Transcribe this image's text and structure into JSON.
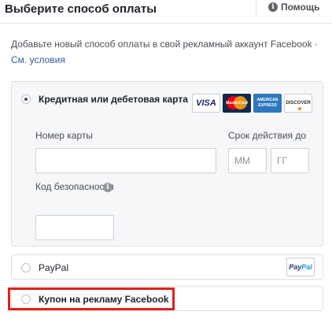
{
  "header": {
    "title": "Выберите способ оплаты",
    "help_label": "Помощь",
    "help_icon_glyph": "i"
  },
  "description": {
    "text": "Добавьте новый способ оплаты в свой рекламный аккаунт Facebook ·",
    "link": "См. условия"
  },
  "card_option": {
    "label": "Кредитная или дебетовая карта",
    "selected": true,
    "logos": {
      "visa": "VISA",
      "mastercard": "MasterCard",
      "amex": "AMERICAN EXPRESS",
      "discover": "DISCOVER"
    },
    "card_number_label": "Номер карты",
    "card_number_value": "",
    "expiry_label": "Срок действия до",
    "expiry_month_placeholder": "ММ",
    "expiry_year_placeholder": "ГГ",
    "security_label": "Код безопасности",
    "security_value": "",
    "info_icon_glyph": "i"
  },
  "paypal_option": {
    "label": "PayPal",
    "logo_pay": "Pay",
    "logo_pal": "Pal",
    "selected": false
  },
  "coupon_option": {
    "label": "Купон на рекламу Facebook",
    "selected": false,
    "highlighted": true
  },
  "colors": {
    "link": "#365899",
    "highlight_border": "#e0221c",
    "card_box_bg": "#f6f7f9"
  }
}
